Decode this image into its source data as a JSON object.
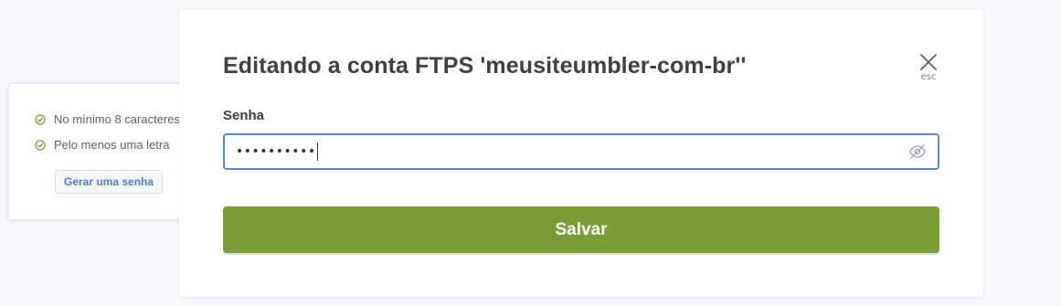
{
  "modal": {
    "title": "Editando a conta FTPS 'meusiteumbler-com-br''",
    "close_label": "esc",
    "password_label": "Senha",
    "password_value": "••••••••••",
    "save_label": "Salvar"
  },
  "password_rules": {
    "items": [
      {
        "label": "No mínimo 8 caracteres",
        "icon": "check-circle-icon",
        "status": "met"
      },
      {
        "label": "Pelo menos uma letra",
        "icon": "check-circle-icon",
        "status": "met"
      }
    ],
    "generate_label": "Gerar uma senha"
  },
  "colors": {
    "accent_blue": "#5b86d6",
    "save_green": "#7a9e35",
    "check_green": "#7a9e35",
    "title_text": "#3b4049"
  },
  "icons": {
    "close": "close-icon",
    "visibility_toggle": "eye-off-icon"
  }
}
